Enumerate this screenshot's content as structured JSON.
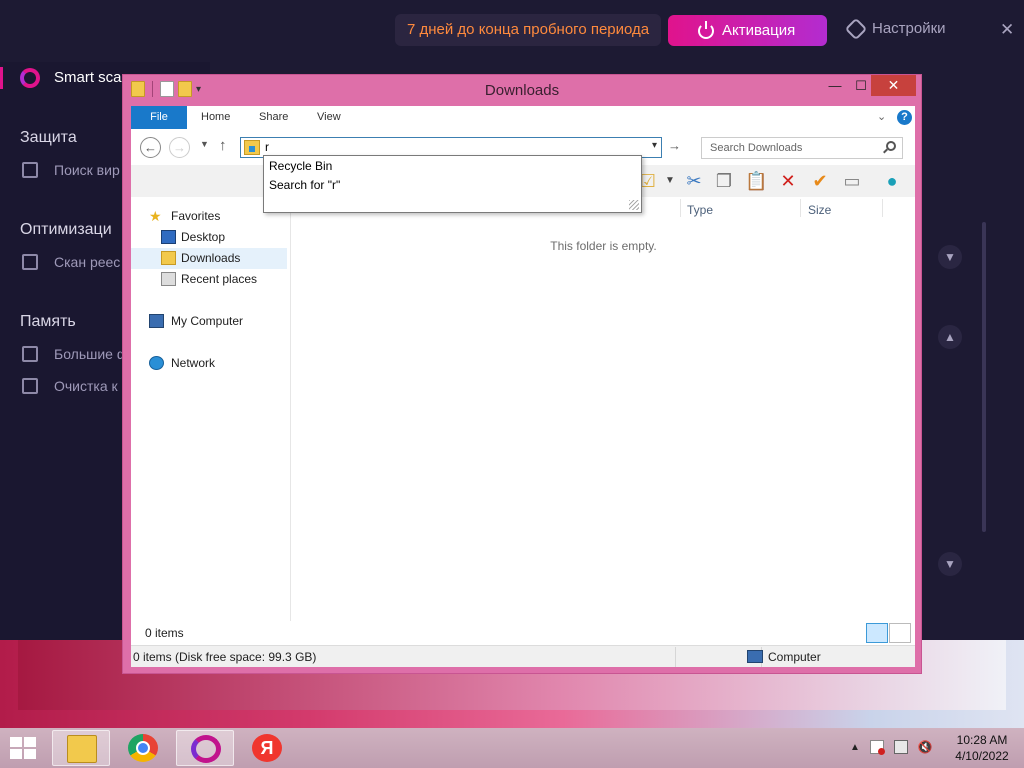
{
  "bg_app": {
    "trial_text": "7 дней до конца пробного периода",
    "activate_label": "Активация",
    "settings_label": "Настройки",
    "close_glyph": "✕",
    "sidebar": {
      "smart_scan": "Smart sca",
      "section_protection": "Защита",
      "item_antivirus": "Поиск вир",
      "section_optimization": "Оптимизаци",
      "item_registry": "Скан реес",
      "section_memory": "Память",
      "item_big_files": "Большие ф",
      "item_cleanup": "Очистка к"
    }
  },
  "window": {
    "title": "Downloads",
    "buttons": {
      "minimize": "—",
      "maximize": "☐",
      "close": "✕"
    },
    "ribbon_tabs": {
      "file": "File",
      "home": "Home",
      "share": "Share",
      "view": "View"
    },
    "address": {
      "value": "r",
      "dropdown": "▾"
    },
    "go_arrow": "→",
    "search_placeholder": "Search Downloads",
    "autocomplete": [
      "Recycle Bin",
      "Search for \"r\""
    ],
    "columns": {
      "type": "Type",
      "size": "Size"
    },
    "empty_message": "This folder is empty.",
    "nav": {
      "favorites": "Favorites",
      "desktop": "Desktop",
      "downloads": "Downloads",
      "recent": "Recent places",
      "computer": "My Computer",
      "network": "Network"
    },
    "status_items": "0 items",
    "status_detail": "0 items (Disk free space: 99.3 GB)",
    "status_location": "Computer"
  },
  "taskbar": {
    "clock_time": "10:28 AM",
    "clock_date": "4/10/2022",
    "tray_up": "▲",
    "apps": [
      "file-explorer",
      "chrome",
      "opera",
      "yandex"
    ],
    "yandex_glyph": "Я"
  },
  "colors": {
    "accent_pink": "#e0138c",
    "window_frame": "#de6fa9",
    "file_tab": "#1979ca",
    "close_button": "#c7413d",
    "trial_text": "#ff8a3d"
  }
}
